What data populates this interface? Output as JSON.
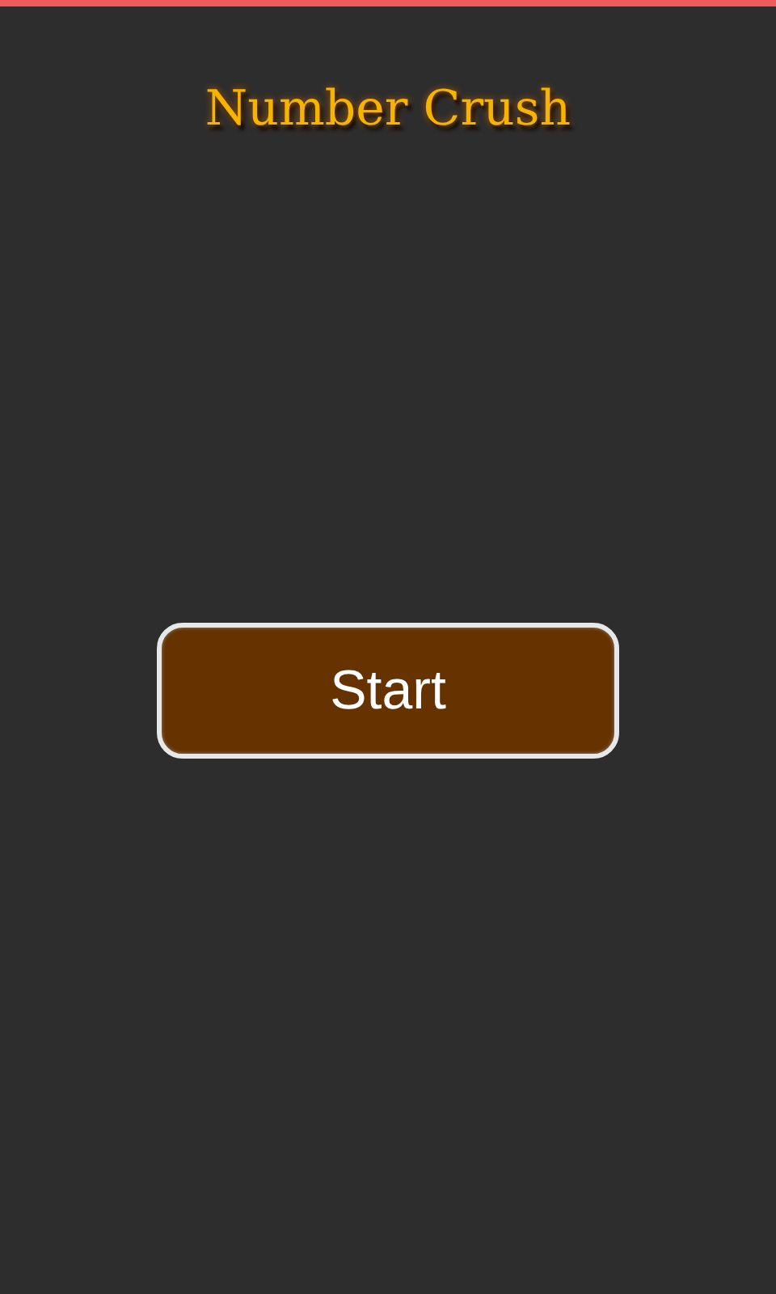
{
  "title": "Number Crush",
  "start_button": {
    "label": "Start"
  }
}
